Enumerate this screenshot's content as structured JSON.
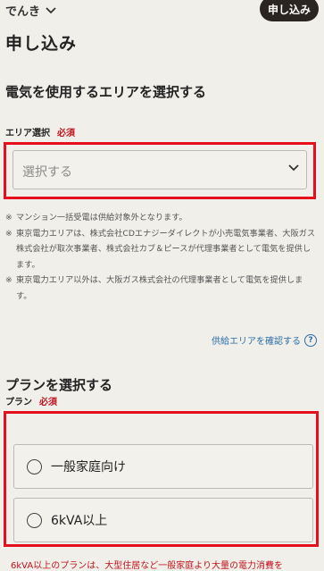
{
  "header": {
    "brand": "でんき",
    "apply_button": "申し込み"
  },
  "page_title": "申し込み",
  "area_section": {
    "title": "電気を使用するエリアを選択する",
    "field_label": "エリア選択",
    "required": "必須",
    "select_placeholder": "選択する",
    "notes": [
      {
        "mark": "※",
        "text": "マンション一括受電は供給対象外となります。"
      },
      {
        "mark": "※",
        "text": "東京電力エリアは、株式会社CDエナジーダイレクトが小売電気事業者、大阪ガス株式会社が取次事業者、株式会社カブ＆ピースが代理事業者として電気を提供します。"
      },
      {
        "mark": "※",
        "text": "東京電力エリア以外は、大阪ガス株式会社の代理事業者として電気を提供します。"
      }
    ],
    "supply_link": "供給エリアを確認する",
    "help_glyph": "?"
  },
  "plan_section": {
    "title": "プランを選択する",
    "field_label": "プラン",
    "required": "必須",
    "options": [
      {
        "label": "一般家庭向け"
      },
      {
        "label": "6kVA以上"
      }
    ],
    "footnote": "6kVA以上のプランは、大型住居など一般家庭より大量の電力消費を"
  },
  "colors": {
    "background": "#f1efea",
    "highlight": "#e60f1d",
    "required": "#c0141e",
    "link": "#2b6ea8",
    "button": "#2b2522"
  },
  "icons": {
    "brand_dropdown": "chevron-down-icon",
    "select_chevron": "chevron-down-icon",
    "help": "help-circle-icon"
  }
}
